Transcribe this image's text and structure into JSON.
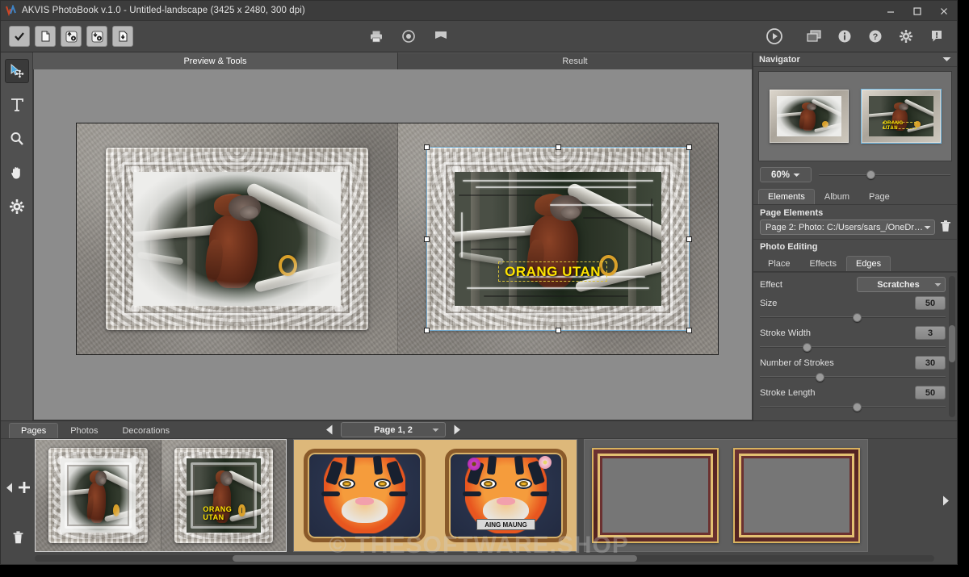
{
  "window": {
    "title": "AKVIS PhotoBook v.1.0 - Untitled-landscape (3425 x 2480, 300 dpi)",
    "minimize_label": "Minimize",
    "maximize_label": "Maximize",
    "close_label": "Close"
  },
  "toolbar": {
    "left_buttons": [
      {
        "name": "accept-icon",
        "label": "Accept"
      },
      {
        "name": "new-file-icon",
        "label": "New"
      },
      {
        "name": "open-settings-up-icon",
        "label": "Load Settings"
      },
      {
        "name": "save-settings-down-icon",
        "label": "Save Settings"
      },
      {
        "name": "save-file-icon",
        "label": "Save"
      }
    ],
    "center_buttons": [
      {
        "name": "print-icon",
        "label": "Print"
      },
      {
        "name": "preview-eye-icon",
        "label": "Preview"
      },
      {
        "name": "book-icon",
        "label": "PhotoBook"
      }
    ],
    "run_button": {
      "name": "run-icon",
      "label": "Run"
    },
    "right_buttons": [
      {
        "name": "windows-icon",
        "label": "Windows"
      },
      {
        "name": "info-icon",
        "label": "Info"
      },
      {
        "name": "help-icon",
        "label": "Help"
      },
      {
        "name": "settings-gear-icon",
        "label": "Preferences"
      },
      {
        "name": "comment-icon",
        "label": "Comments"
      }
    ]
  },
  "left_tools": [
    {
      "name": "transform-tool",
      "label": "Transform",
      "active": true
    },
    {
      "name": "text-tool",
      "label": "Text",
      "active": false
    },
    {
      "name": "zoom-tool",
      "label": "Zoom",
      "active": false
    },
    {
      "name": "hand-tool",
      "label": "Hand",
      "active": false
    },
    {
      "name": "gear-tool",
      "label": "Settings",
      "active": false
    }
  ],
  "view_tabs": [
    {
      "label": "Preview & Tools",
      "selected": true
    },
    {
      "label": "Result",
      "selected": false
    }
  ],
  "canvas": {
    "left_page": {
      "caption": ""
    },
    "right_page": {
      "caption": "ORANG UTAN"
    }
  },
  "navigator": {
    "title": "Navigator",
    "collapse_icon": "chevron-down-icon",
    "zoom_value": "60%",
    "zoom_slider_percent": 36
  },
  "panel_tabs": [
    {
      "label": "Elements",
      "selected": true
    },
    {
      "label": "Album",
      "selected": false
    },
    {
      "label": "Page",
      "selected": false
    }
  ],
  "page_elements": {
    "title": "Page Elements",
    "selected": "Page 2: Photo: C:/Users/sars_/OneDriv...",
    "delete_icon": "trash-icon"
  },
  "photo_editing": {
    "title": "Photo Editing",
    "tabs": [
      {
        "label": "Place",
        "selected": false
      },
      {
        "label": "Effects",
        "selected": false
      },
      {
        "label": "Edges",
        "selected": true
      }
    ],
    "effect_label": "Effect",
    "effect_value": "Scratches",
    "params": [
      {
        "label": "Size",
        "value": "50",
        "percent": 50
      },
      {
        "label": "Stroke Width",
        "value": "3",
        "percent": 23
      },
      {
        "label": "Number of Strokes",
        "value": "30",
        "percent": 30
      },
      {
        "label": "Stroke Length",
        "value": "50",
        "percent": 50
      }
    ]
  },
  "bottom": {
    "tabs": [
      {
        "label": "Pages",
        "selected": true
      },
      {
        "label": "Photos",
        "selected": false
      },
      {
        "label": "Decorations",
        "selected": false
      }
    ],
    "page_nav": {
      "prev_icon": "prev-arrow-icon",
      "next_icon": "next-arrow-icon",
      "current": "Page 1, 2"
    },
    "filmstrip_controls": {
      "scroll_left_icon": "scroll-left-icon",
      "add_icon": "plus-icon",
      "delete_icon": "trash-icon",
      "scroll_right_icon": "scroll-right-icon"
    },
    "spreads": [
      {
        "name": "orangutan-spread",
        "selected": true,
        "caption": "ORANG UTAN"
      },
      {
        "name": "tiger-spread",
        "selected": false,
        "caption": "AING MAUNG"
      },
      {
        "name": "empty-gold-frames-spread",
        "selected": false,
        "caption": ""
      }
    ]
  },
  "watermark": "© THESOFTWARE.SHOP",
  "colors": {
    "app_bg": "#484848",
    "titlebar": "#3c3c3c",
    "panel": "#4b4b4b",
    "canvas_bg": "#8c8c8c",
    "accent_caption": "#ffe400",
    "selection": "#78b4dc"
  }
}
